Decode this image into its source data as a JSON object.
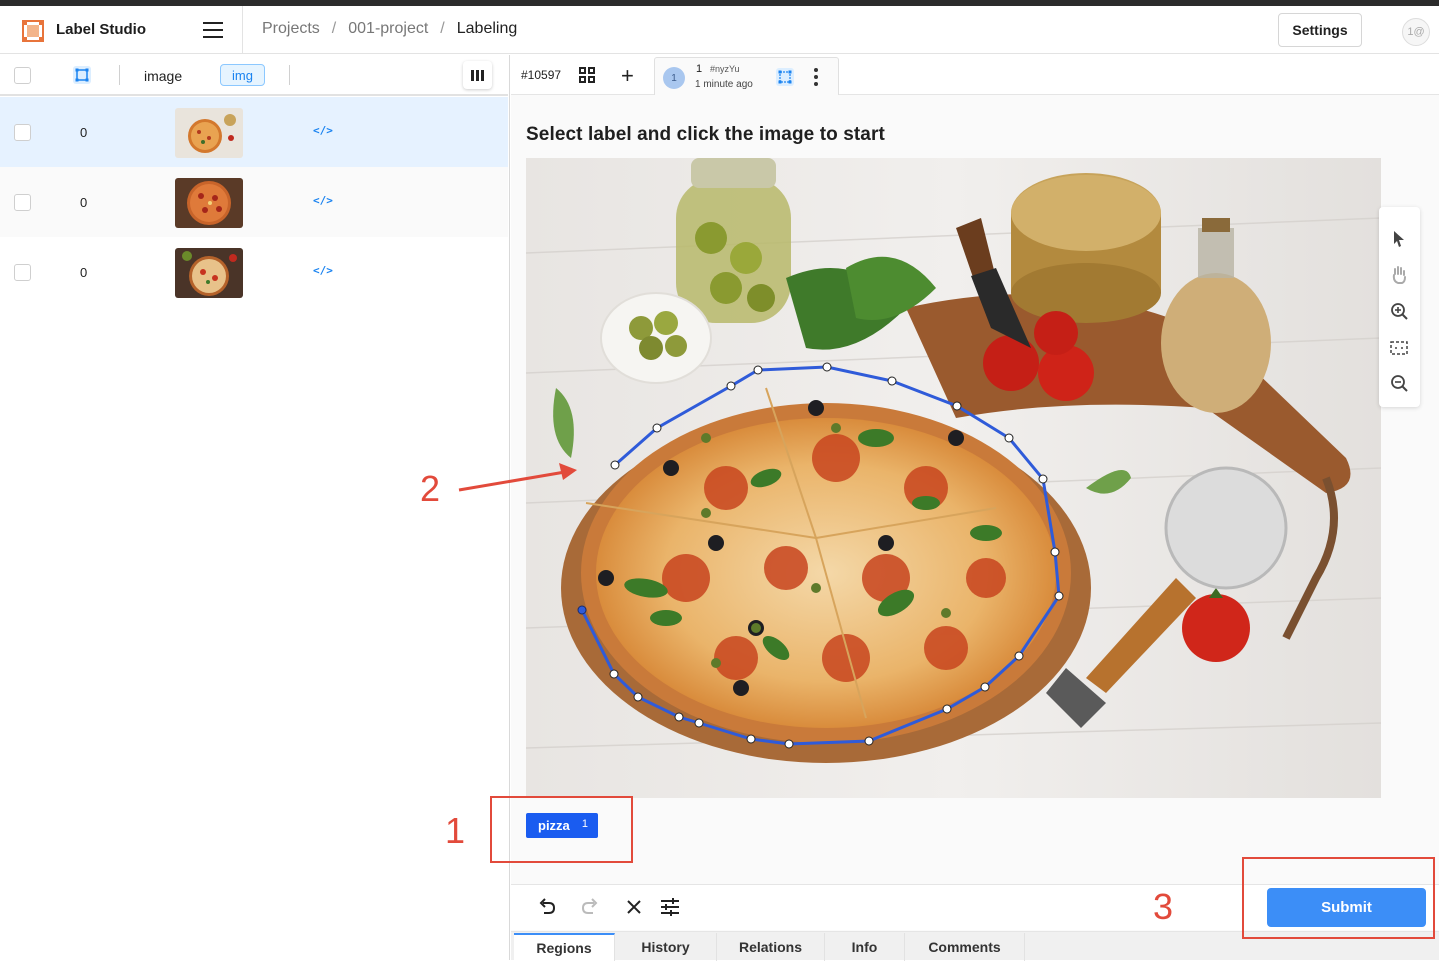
{
  "header": {
    "app_title": "Label Studio",
    "breadcrumb": [
      "Projects",
      "001-project",
      "Labeling"
    ],
    "settings_label": "Settings",
    "avatar_initials": "1@"
  },
  "table": {
    "columns": {
      "image": "image",
      "img_tag": "img"
    },
    "rows": [
      {
        "count": "0",
        "code": "</>",
        "selected": true
      },
      {
        "count": "0",
        "code": "</>",
        "selected": false
      },
      {
        "count": "0",
        "code": "</>",
        "selected": false
      }
    ]
  },
  "task": {
    "id": "#10597",
    "annotation": {
      "avatar": "1",
      "number": "1",
      "tag": "#nyzYu",
      "time": "1 minute ago"
    }
  },
  "editor": {
    "instruction": "Select label and click the image to start",
    "label": {
      "name": "pizza",
      "hotkey": "1",
      "color": "#1a5cf0"
    },
    "submit_label": "Submit"
  },
  "tabs": [
    "Regions",
    "History",
    "Relations",
    "Info",
    "Comments"
  ],
  "annotations_overlay": {
    "step_1": "1",
    "step_2": "2",
    "step_3": "3",
    "color": "#e24a3b"
  }
}
